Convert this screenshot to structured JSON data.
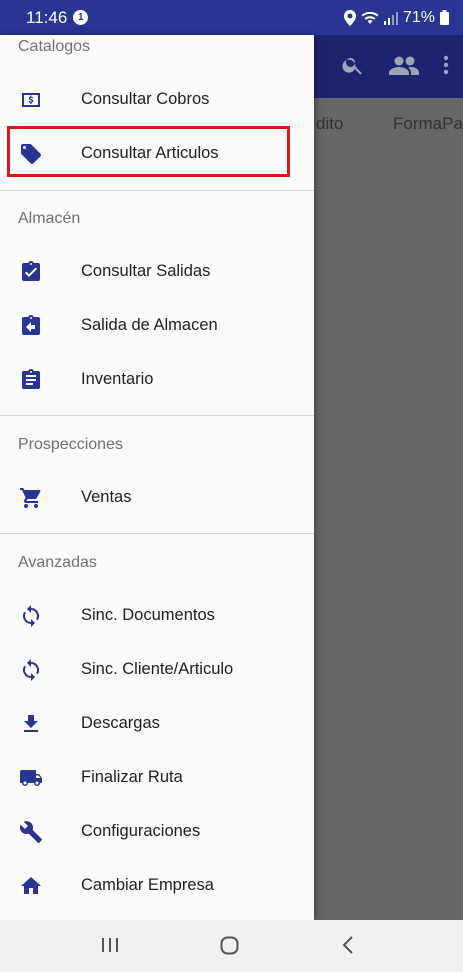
{
  "status_bar": {
    "time": "11:46",
    "notification_count": "1",
    "battery": "71%"
  },
  "app": {
    "column_headers": [
      "dito",
      "FormaPa"
    ]
  },
  "drawer": {
    "sections": [
      {
        "header": "Catalogos",
        "items": [
          {
            "label": "Consultar Cobros",
            "icon": "money-icon"
          },
          {
            "label": "Consultar Articulos",
            "icon": "tag-icon"
          }
        ]
      },
      {
        "header": "Almacén",
        "items": [
          {
            "label": "Consultar Salidas",
            "icon": "clipboard-check-icon"
          },
          {
            "label": "Salida de Almacen",
            "icon": "clipboard-arrow-left-icon"
          },
          {
            "label": "Inventario",
            "icon": "clipboard-text-icon"
          }
        ]
      },
      {
        "header": "Prospecciones",
        "items": [
          {
            "label": "Ventas",
            "icon": "cart-icon"
          }
        ]
      },
      {
        "header": "Avanzadas",
        "items": [
          {
            "label": "Sinc. Documentos",
            "icon": "sync-icon"
          },
          {
            "label": "Sinc. Cliente/Articulo",
            "icon": "sync-icon"
          },
          {
            "label": "Descargas",
            "icon": "download-icon"
          },
          {
            "label": "Finalizar Ruta",
            "icon": "truck-icon"
          },
          {
            "label": "Configuraciones",
            "icon": "wrench-icon"
          },
          {
            "label": "Cambiar Empresa",
            "icon": "home-icon"
          }
        ]
      }
    ]
  },
  "colors": {
    "primary": "#283593",
    "highlight": "#d61a1a"
  }
}
